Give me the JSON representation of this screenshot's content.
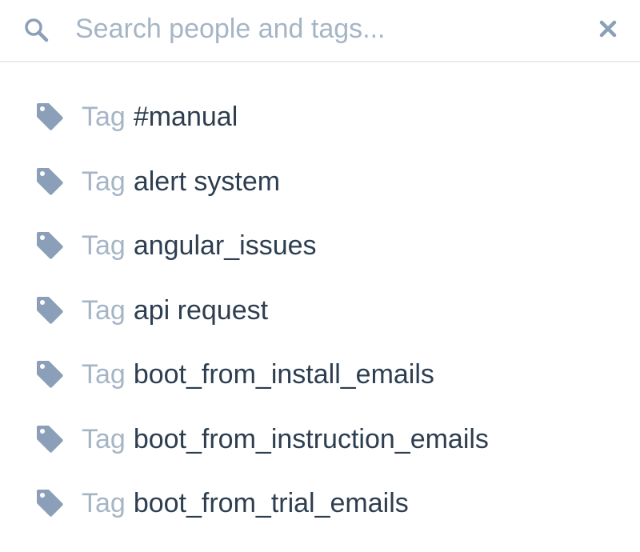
{
  "search": {
    "value": "",
    "placeholder": "Search people and tags..."
  },
  "results": [
    {
      "type": "Tag",
      "name": "#manual"
    },
    {
      "type": "Tag",
      "name": "alert system"
    },
    {
      "type": "Tag",
      "name": "angular_issues"
    },
    {
      "type": "Tag",
      "name": "api request"
    },
    {
      "type": "Tag",
      "name": "boot_from_install_emails"
    },
    {
      "type": "Tag",
      "name": "boot_from_instruction_emails"
    },
    {
      "type": "Tag",
      "name": "boot_from_trial_emails"
    }
  ],
  "icons": {
    "search": "search-icon",
    "clear": "close-icon",
    "tag": "tag-icon"
  },
  "colors": {
    "icon": "#8ba0b8",
    "placeholder": "#a6b5c6",
    "label_muted": "#a6b5c6",
    "text": "#2d3e50",
    "divider": "#e6ebf0"
  }
}
